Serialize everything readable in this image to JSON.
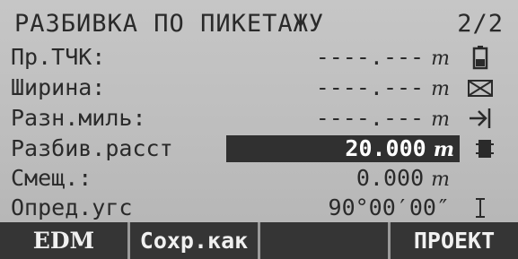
{
  "header": {
    "title": "РАЗБИВКА ПО ПИКЕТАЖУ",
    "page": "2/2"
  },
  "fields": [
    {
      "label": "Пр.ТЧК:",
      "value": "----.---",
      "unit": "m",
      "icon": "battery-icon"
    },
    {
      "label": "Ширина:",
      "value": "----.---",
      "unit": "m",
      "icon": "no-signal-icon"
    },
    {
      "label": "Разн.миль:",
      "value": "----.---",
      "unit": "m",
      "icon": "prism-target-icon"
    },
    {
      "label": "Разбив.расст",
      "value": "20.000",
      "unit": "m",
      "icon": "tilt-compensator-icon"
    },
    {
      "label": "Смещ.:",
      "value": "0.000",
      "unit": "m",
      "icon": ""
    },
    {
      "label": "Опред.угс",
      "value": "90°00′00″",
      "unit": "",
      "icon": "text-cursor-icon"
    }
  ],
  "softkeys": [
    "EDM",
    "Сохр.как",
    "",
    "ПРОЕКТ"
  ]
}
